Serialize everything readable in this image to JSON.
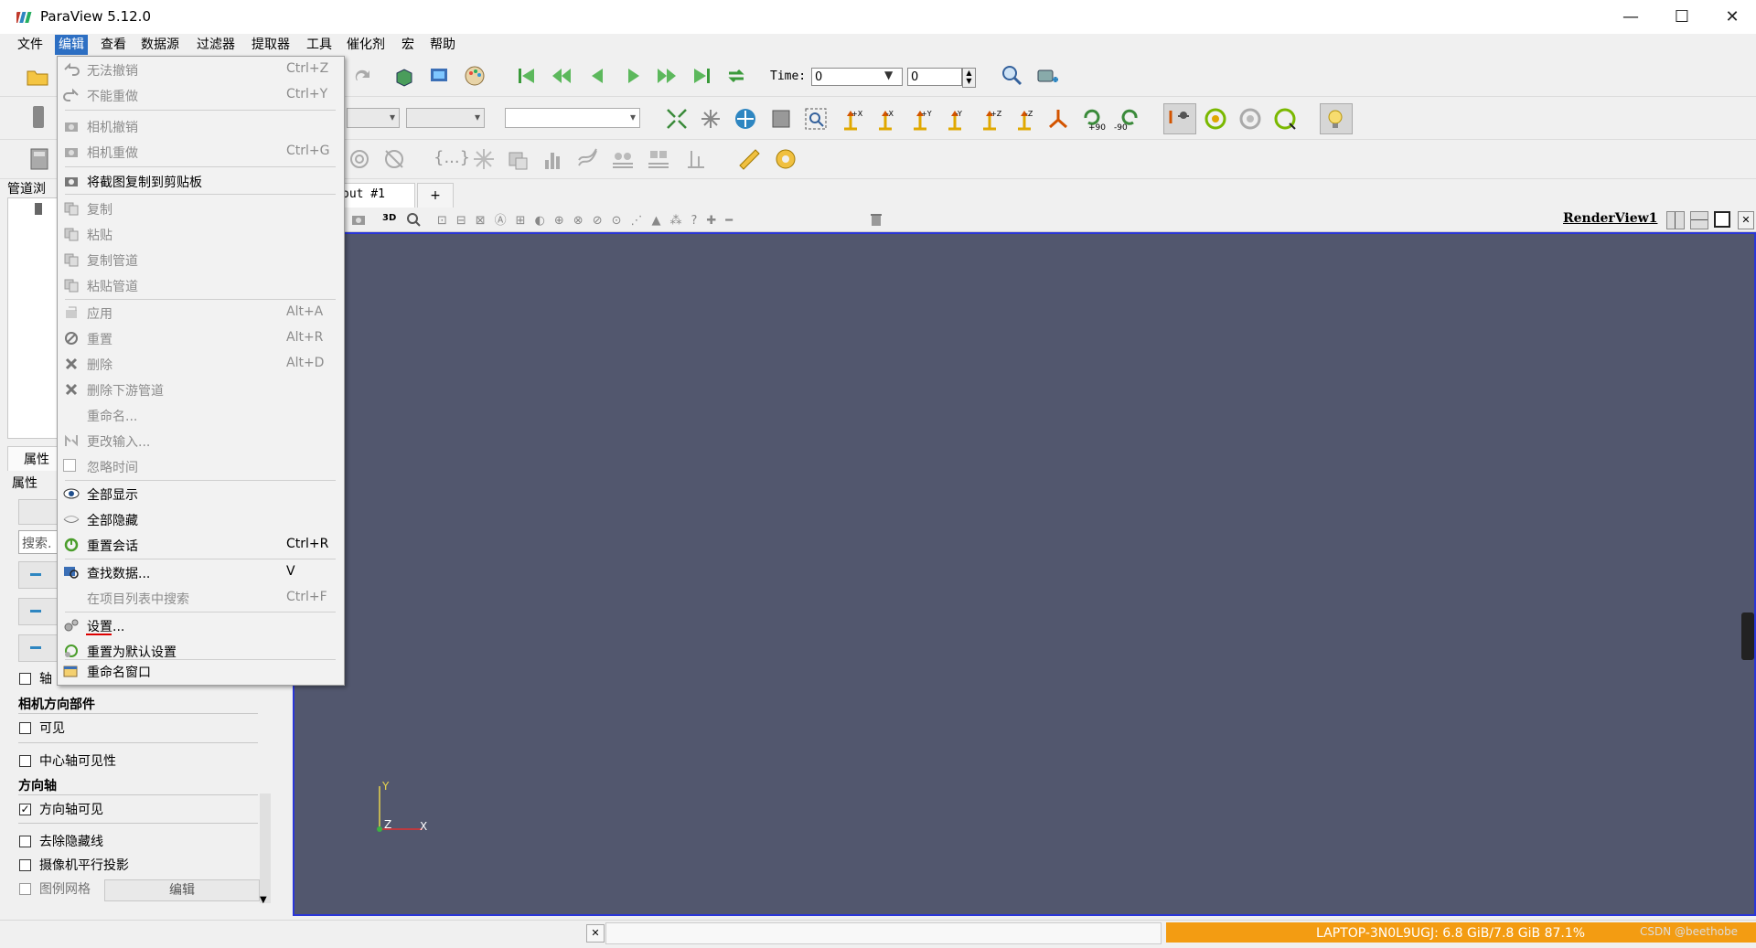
{
  "window": {
    "title": "ParaView 5.12.0",
    "minimize_glyph": "—",
    "maximize_glyph": "☐",
    "close_glyph": "✕"
  },
  "menubar": {
    "items": [
      "文件",
      "编辑",
      "查看",
      "数据源",
      "过滤器",
      "提取器",
      "工具",
      "催化剂",
      "宏",
      "帮助"
    ],
    "active": "编辑"
  },
  "toolbar": {
    "time_label": "Time:",
    "time_value": "0",
    "timestep_value": "0",
    "rotate_plus_label": "+90",
    "rotate_minus_label": "-90",
    "axis_labels": [
      "+X",
      "-X",
      "+Y",
      "-Y",
      "+Z",
      "-Z"
    ]
  },
  "edit_menu": {
    "items": [
      {
        "label": "无法撤销",
        "shortcut": "Ctrl+Z",
        "disabled": true,
        "icon": "undo-icon"
      },
      {
        "label": "不能重做",
        "shortcut": "Ctrl+Y",
        "disabled": true,
        "icon": "redo-icon"
      },
      {
        "sep": true
      },
      {
        "label": "相机撤销",
        "shortcut": "",
        "disabled": true,
        "icon": "camera-undo-icon"
      },
      {
        "label": "相机重做",
        "shortcut": "Ctrl+G",
        "disabled": true,
        "icon": "camera-redo-icon"
      },
      {
        "sep": true
      },
      {
        "label": "将截图复制到剪贴板",
        "shortcut": "",
        "disabled": false,
        "icon": "screenshot-icon"
      },
      {
        "sep": true
      },
      {
        "label": "复制",
        "shortcut": "",
        "disabled": true,
        "icon": "copy-icon"
      },
      {
        "label": "粘贴",
        "shortcut": "",
        "disabled": true,
        "icon": "paste-icon"
      },
      {
        "label": "复制管道",
        "shortcut": "",
        "disabled": true,
        "icon": "copy-pipeline-icon"
      },
      {
        "label": "粘贴管道",
        "shortcut": "",
        "disabled": true,
        "icon": "paste-pipeline-icon"
      },
      {
        "sep": true
      },
      {
        "label": "应用",
        "shortcut": "Alt+A",
        "disabled": true,
        "icon": "apply-icon"
      },
      {
        "label": "重置",
        "shortcut": "Alt+R",
        "disabled": true,
        "icon": "reset-icon"
      },
      {
        "label": "删除",
        "shortcut": "Alt+D",
        "disabled": true,
        "icon": "delete-icon"
      },
      {
        "label": "删除下游管道",
        "shortcut": "",
        "disabled": true,
        "icon": "delete-downstream-icon"
      },
      {
        "label": "重命名...",
        "shortcut": "",
        "disabled": true,
        "icon": ""
      },
      {
        "label": "更改输入...",
        "shortcut": "",
        "disabled": true,
        "icon": "change-input-icon"
      },
      {
        "label": "忽略时间",
        "shortcut": "",
        "disabled": true,
        "icon": "checkbox-icon"
      },
      {
        "sep": true
      },
      {
        "label": "全部显示",
        "shortcut": "",
        "disabled": false,
        "icon": "eye-open-icon"
      },
      {
        "label": "全部隐藏",
        "shortcut": "",
        "disabled": false,
        "icon": "eye-closed-icon"
      },
      {
        "label": "重置会话",
        "shortcut": "Ctrl+R",
        "disabled": false,
        "icon": "reset-session-icon"
      },
      {
        "sep": true
      },
      {
        "label": "查找数据...",
        "shortcut": "V",
        "disabled": false,
        "icon": "find-data-icon"
      },
      {
        "label": "在项目列表中搜索",
        "shortcut": "Ctrl+F",
        "disabled": true,
        "icon": ""
      },
      {
        "sep": true
      },
      {
        "label": "设置...",
        "shortcut": "",
        "disabled": false,
        "icon": "settings-icon"
      },
      {
        "label": "重置为默认设置",
        "shortcut": "",
        "disabled": false,
        "icon": "reset-default-icon"
      },
      {
        "sep": true
      },
      {
        "label": "重命名窗口",
        "shortcut": "",
        "disabled": false,
        "icon": "rename-window-icon"
      }
    ]
  },
  "pipeline_browser": {
    "title": "管道浏"
  },
  "layout_tab": {
    "label": "out #1",
    "add_label": "+"
  },
  "render_view": {
    "name": "RenderView1",
    "view_buttons": [
      "3D"
    ],
    "axis_y": "Y",
    "axis_x": "X",
    "axis_z": "Z",
    "colors": {
      "background": "#52576e",
      "frame": "#2a36d8"
    }
  },
  "properties": {
    "tab_label": "属性",
    "sub_label": "属性",
    "search_placeholder": "搜索.",
    "sections": [
      {
        "type": "check",
        "label": "轴",
        "checked": false
      },
      {
        "type": "header",
        "label": "相机方向部件"
      },
      {
        "type": "check",
        "label": "可见",
        "checked": false
      },
      {
        "type": "check",
        "label": "中心轴可见性",
        "checked": false
      },
      {
        "type": "header",
        "label": "方向轴"
      },
      {
        "type": "check",
        "label": "方向轴可见",
        "checked": true
      },
      {
        "type": "check",
        "label": "去除隐藏线",
        "checked": false
      },
      {
        "type": "check",
        "label": "摄像机平行投影",
        "checked": false
      },
      {
        "type": "check",
        "label": "图例网格",
        "checked": false
      }
    ],
    "edit_button": "编辑",
    "check_glyph": "✓"
  },
  "statusbar": {
    "close_glyph": "✕",
    "memory": "LAPTOP-3N0L9UGJ: 6.8 GiB/7.8 GiB 87.1%",
    "watermark": "CSDN @beethobe",
    "colors": {
      "memory_bar": "#f39c12"
    }
  }
}
